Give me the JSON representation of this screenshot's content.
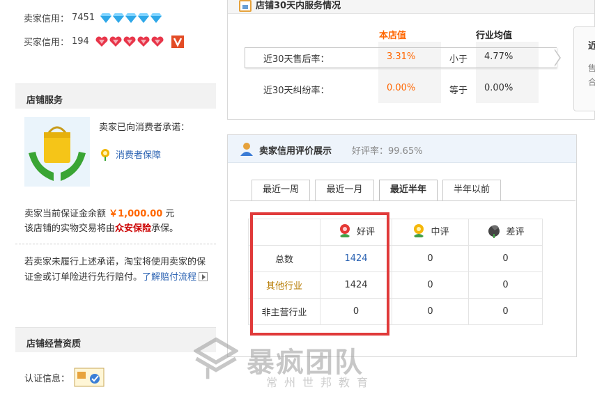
{
  "seller_credit": {
    "label": "卖家信用：",
    "value": "7451"
  },
  "buyer_credit": {
    "label": "买家信用：",
    "value": "194"
  },
  "shop_service": {
    "title": "店铺服务",
    "promise": "卖家已向消费者承诺：",
    "protection": "消费者保障",
    "deposit_prefix": "卖家当前保证金余额 ",
    "deposit_amount": "￥1,000.00",
    "deposit_suffix": " 元",
    "insurance_prefix": "该店铺的实物交易将由",
    "insurance_name": "众安保险",
    "insurance_suffix": "承保。",
    "promise_text": "若卖家未履行上述承诺，淘宝将使用卖家的保证金或订单险进行先行赔付。",
    "learn_link": "了解赔付流程"
  },
  "shop_qualification": {
    "title": "店铺经营资质",
    "cert_label": "认证信息："
  },
  "service_30d": {
    "title": "店铺30天内服务情况",
    "col_own": "本店值",
    "col_avg": "行业均值",
    "rows": [
      {
        "label": "近30天售后率：",
        "own": "3.31%",
        "compare": "小于",
        "avg": "4.77%"
      },
      {
        "label": "近30天纠纷率：",
        "own": "0.00%",
        "compare": "等于",
        "avg": "0.00%"
      }
    ],
    "side_card_title": "近",
    "side_card_sub1": "售",
    "side_card_sub2": "合"
  },
  "rating": {
    "title": "卖家信用评价展示",
    "good_rate": "好评率：99.65%",
    "tabs": [
      "最近一周",
      "最近一月",
      "最近半年",
      "半年以前"
    ],
    "active_tab": "最近半年",
    "headers": [
      "好评",
      "中评",
      "差评"
    ],
    "rows": [
      {
        "label": "总数",
        "good": "1424",
        "mid": "0",
        "bad": "0"
      },
      {
        "label": "其他行业",
        "good": "1424",
        "mid": "0",
        "bad": "0"
      },
      {
        "label": "非主营行业",
        "good": "0",
        "mid": "0",
        "bad": "0"
      }
    ]
  },
  "watermark": {
    "main": "暴疯团队",
    "sub": "常州世邦教育"
  },
  "colors": {
    "accent": "#f60",
    "link": "#2d64b3",
    "highlight": "#e03a3a"
  }
}
